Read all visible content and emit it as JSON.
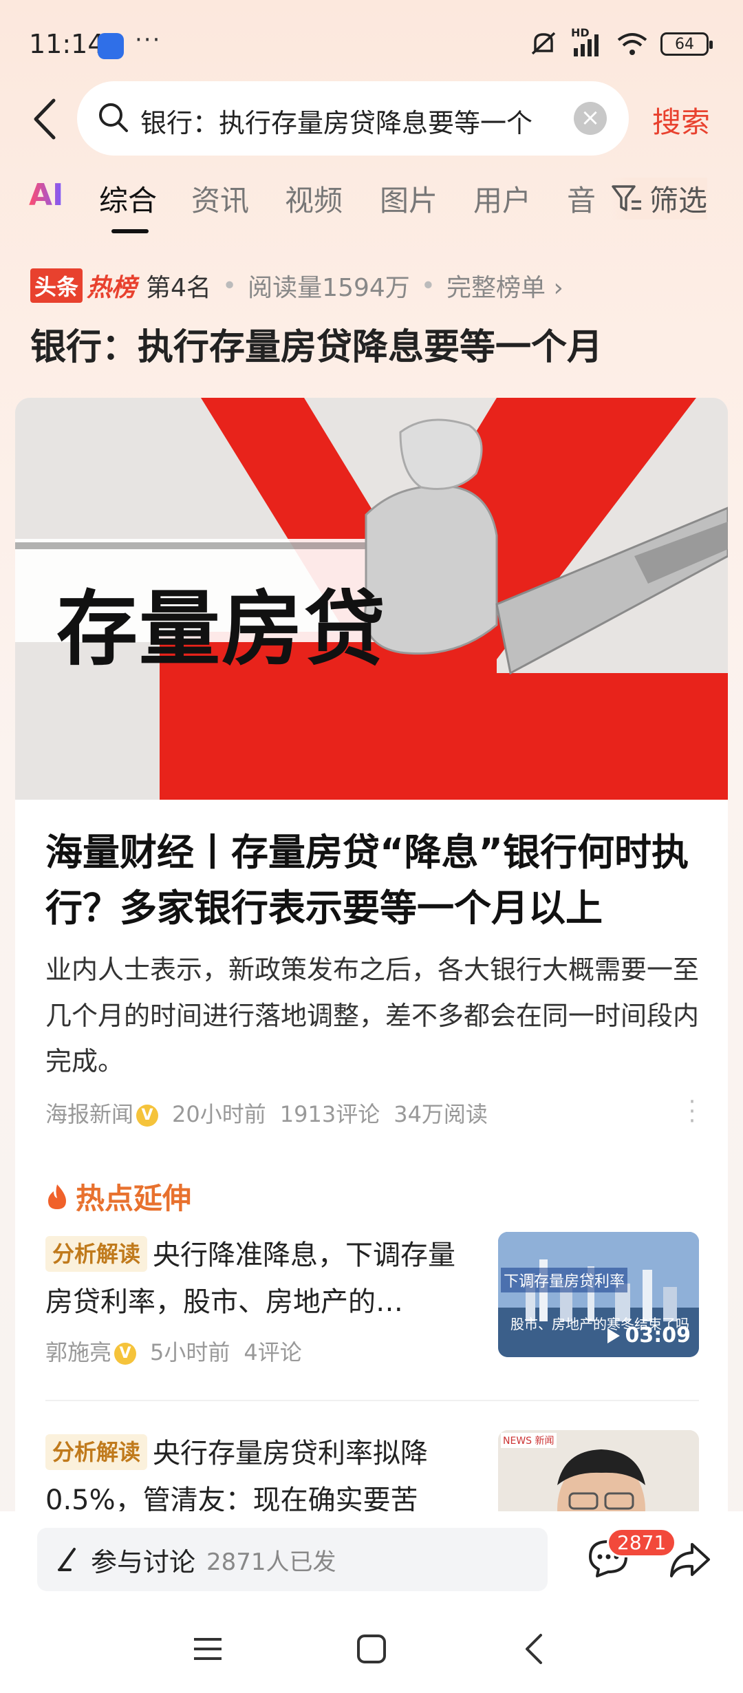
{
  "status": {
    "time": "11:14",
    "more": "···",
    "battery": "64",
    "network": "HD"
  },
  "search": {
    "query": "银行：执行存量房贷降息要等一个",
    "clear": "×",
    "button": "搜索"
  },
  "tabs": {
    "ai": "AI",
    "items": [
      "综合",
      "资讯",
      "视频",
      "图片",
      "用户",
      "音"
    ],
    "filter": "筛选"
  },
  "hot": {
    "logo_a": "头条",
    "logo_b": "热榜",
    "rank": "第4名",
    "reads": "阅读量1594万",
    "full_list": "完整榜单 ›"
  },
  "page_title": "银行：执行存量房贷降息要等一个月",
  "hero": {
    "text": "存量房贷"
  },
  "article": {
    "title": "海量财经丨存量房贷“降息”银行何时执行？多家银行表示要等一个月以上",
    "desc": "业内人士表示，新政策发布之后，各大银行大概需要一至几个月的时间进行落地调整，差不多都会在同一时间段内完成。",
    "source": "海报新闻",
    "time": "20小时前",
    "comments": "1913评论",
    "reads": "34万阅读"
  },
  "extension": {
    "title": "热点延伸",
    "items": [
      {
        "tag": "分析解读",
        "text": "央行降准降息，下调存量房贷利率，股市、房地产的…",
        "author": "郭施亮",
        "time": "5小时前",
        "comments": "4评论",
        "thumb_title": "下调存量房贷利率",
        "thumb_sub": "股市、房地产的寒冬结束了吗",
        "duration": "03:09"
      },
      {
        "tag": "分析解读",
        "text": "央行存量房贷利率拟降0.5%，管清友：现在确实要苦",
        "thumb_logo": "NEWS 新闻"
      }
    ]
  },
  "bottom": {
    "discuss": "参与讨论",
    "count": "2871人已发",
    "badge": "2871"
  },
  "colors": {
    "accent": "#e8412e",
    "tag_bg": "#fbf1dc",
    "tag_fg": "#c07a1c",
    "hot_orange": "#e8712e"
  }
}
